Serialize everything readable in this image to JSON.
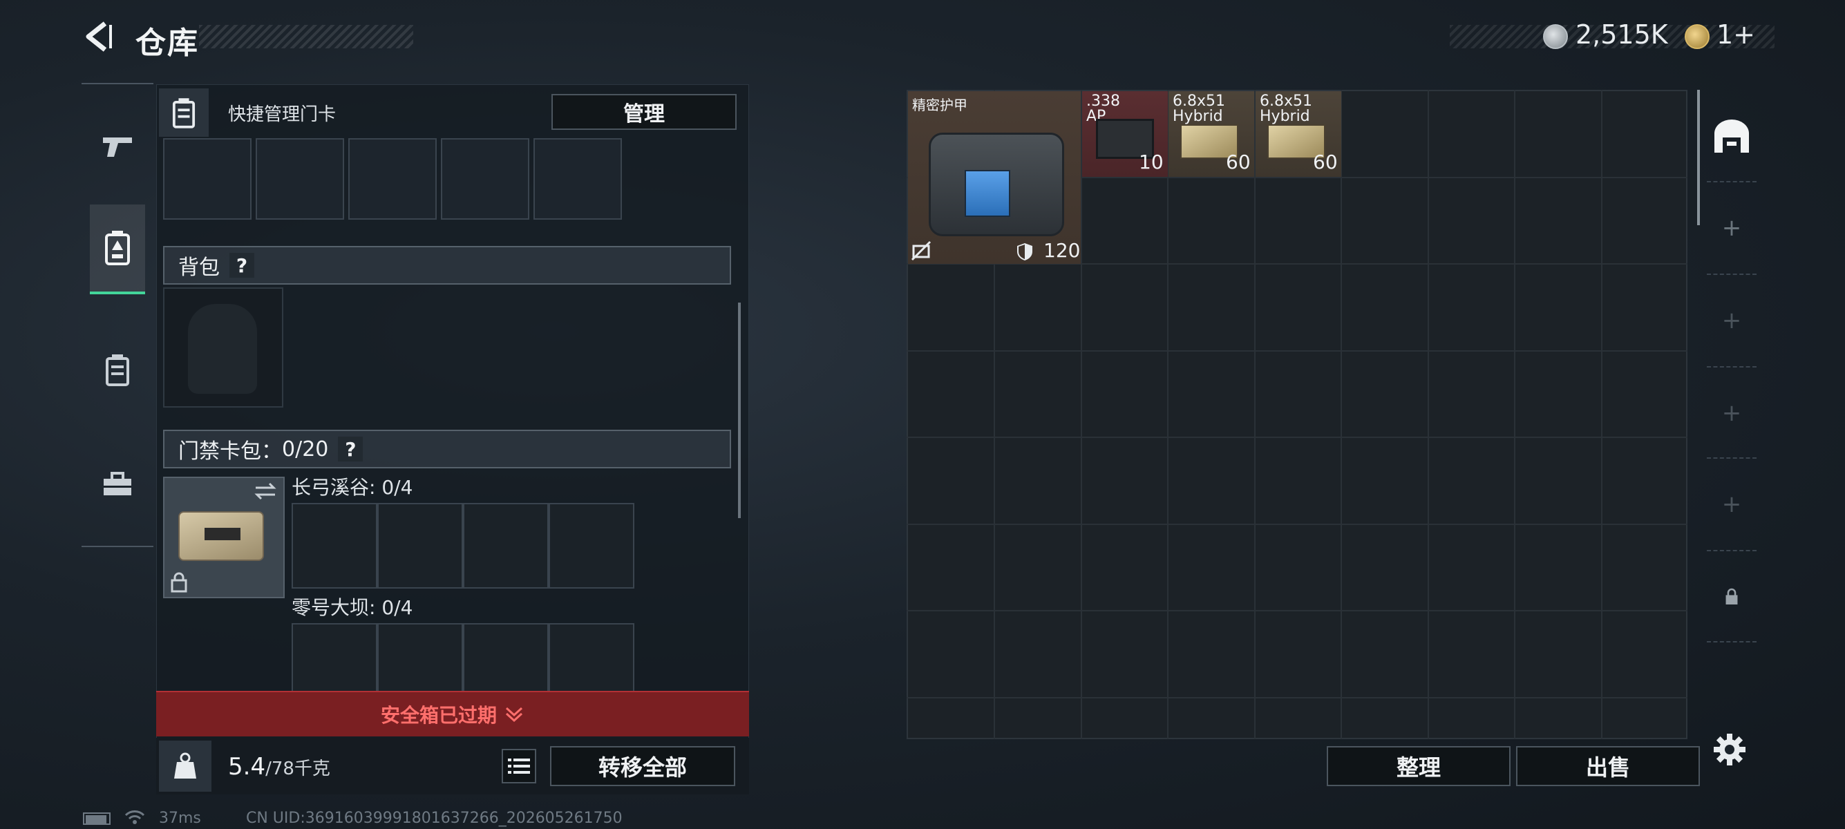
{
  "header": {
    "title": "仓库",
    "currency_1": "2,515K",
    "currency_2": "1+"
  },
  "left_panel": {
    "quick_manage_label": "快捷管理门卡",
    "manage_button": "管理",
    "backpack_title": "背包",
    "backpack_help": "?",
    "keycard_title": "门禁卡包：",
    "keycard_count": "0/20",
    "keycard_help": "?",
    "key_group_1": "长弓溪谷: 0/4",
    "key_group_2": "零号大坝: 0/4",
    "expired_banner": "安全箱已过期",
    "weight_current": "5.4",
    "weight_capacity": "/78千克",
    "transfer_all_button": "转移全部"
  },
  "storage": {
    "items": [
      {
        "name": "精密护甲",
        "value": "120"
      },
      {
        "name_line1": ".338",
        "name_line2": "AP",
        "count": "10"
      },
      {
        "name_line1": "6.8x51",
        "name_line2": "Hybrid",
        "count": "60"
      },
      {
        "name_line1": "6.8x51",
        "name_line2": "Hybrid",
        "count": "60"
      }
    ],
    "sort_button": "整理",
    "sell_button": "出售",
    "add_symbol": "+"
  },
  "status": {
    "ping": "37ms",
    "uid": "CN UID:3691603999180163726​6_202605261750"
  }
}
